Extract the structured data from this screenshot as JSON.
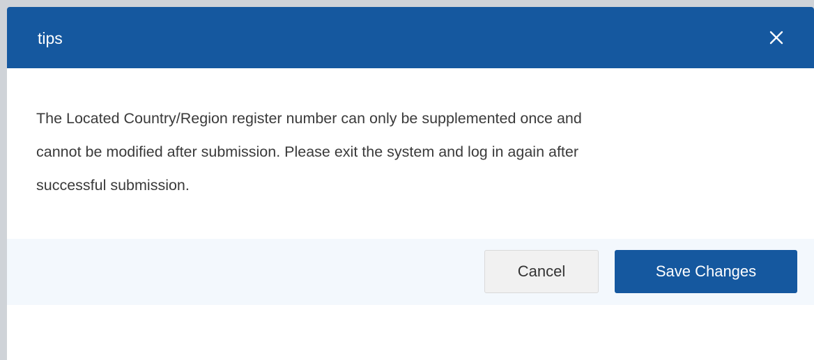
{
  "dialog": {
    "title": "tips",
    "close_icon": "close-icon",
    "message_lines": [
      "The Located Country/Region register number can only be supplemented once and",
      "cannot be modified after submission. Please exit the system and log in again after",
      "successful submission."
    ],
    "buttons": {
      "cancel_label": "Cancel",
      "save_label": "Save Changes"
    }
  },
  "colors": {
    "header_background": "#15589f",
    "primary_button": "#15589f",
    "footer_background": "#f3f8fd",
    "cancel_button_background": "#f1f1f1"
  }
}
